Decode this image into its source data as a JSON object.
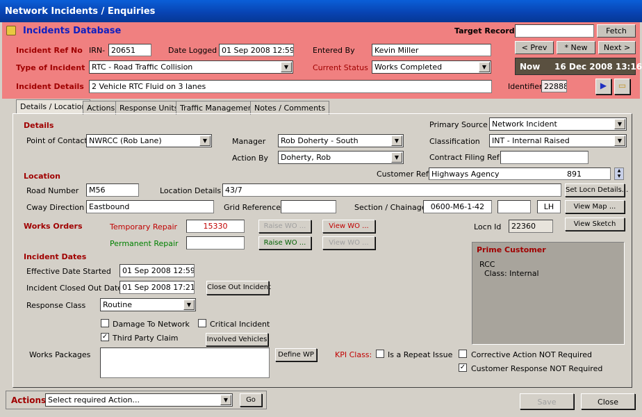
{
  "window": {
    "title": "Network Incidents / Enquiries"
  },
  "header": {
    "db_title": "Incidents Database",
    "target_record_label": "Target Record",
    "target_record_value": "",
    "fetch_label": "Fetch",
    "incident_ref_label": "Incident Ref No",
    "irn_prefix": "IRN-",
    "irn_value": "20651",
    "date_logged_label": "Date Logged",
    "date_logged_value": "01 Sep 2008 12:59",
    "entered_by_label": "Entered By",
    "entered_by_value": "Kevin Miller",
    "prev_label": "< Prev",
    "new_label": "* New",
    "next_label": "Next >",
    "type_label": "Type of Incident",
    "type_value": "RTC - Road Traffic Collision",
    "status_label": "Current Status",
    "status_value": "Works Completed",
    "now_label": "Now",
    "now_value": "16 Dec 2008 13:16",
    "details_label": "Incident Details",
    "details_value": "2 Vehicle RTC Fluid on 3 lanes",
    "identifier_label": "Identifier",
    "identifier_value": "22888"
  },
  "tabs": [
    "Details / Location",
    "Actions",
    "Response Units",
    "Traffic Management",
    "Notes / Comments"
  ],
  "details": {
    "section": "Details",
    "poc_label": "Point of Contact",
    "poc_value": "NWRCC (Rob Lane)",
    "manager_label": "Manager",
    "manager_value": "Rob Doherty - South",
    "action_by_label": "Action By",
    "action_by_value": "Doherty, Rob",
    "primary_source_label": "Primary Source",
    "primary_source_value": "Network Incident",
    "classification_label": "Classification",
    "classification_value": "INT - Internal Raised",
    "contract_filing_label": "Contract Filing Ref",
    "contract_filing_value": ""
  },
  "location": {
    "section": "Location",
    "customer_ref_label": "Customer Ref",
    "customer_ref_value": "Highways Agency",
    "customer_ref_num": "891",
    "road_label": "Road Number",
    "road_value": "M56",
    "loc_details_label": "Location Details",
    "loc_details_value": "43/7",
    "set_locn_label": "Set Locn Details...",
    "cway_label": "Cway Direction",
    "cway_value": "Eastbound",
    "grid_label": "Grid Reference",
    "grid_value": "",
    "section_label": "Section / Chainage",
    "section_value": "0600-M6-1-42",
    "chainage_value": "",
    "side_value": "LH",
    "view_map_label": "View Map ...",
    "view_sketch_label": "View Sketch",
    "locn_id_label": "Locn Id",
    "locn_id_value": "22360"
  },
  "works": {
    "section": "Works Orders",
    "temp_label": "Temporary Repair",
    "temp_value": "15330",
    "perm_label": "Permanent Repair",
    "perm_value": "",
    "raise_wo": "Raise WO ...",
    "view_wo": "View WO ..."
  },
  "dates": {
    "section": "Incident Dates",
    "eff_label": "Effective Date Started",
    "eff_value": "01 Sep 2008 12:59",
    "closed_label": "Incident Closed Out Date",
    "closed_value": "01 Sep 2008 17:21",
    "close_out_label": "Close Out Incident",
    "response_label": "Response Class",
    "response_value": "Routine",
    "damage_label": "Damage To Network",
    "critical_label": "Critical Incident",
    "third_party_label": "Third Party Claim",
    "involved_label": "Involved Vehicles",
    "wp_label": "Works Packages",
    "define_wp_label": "Define WP"
  },
  "kpi": {
    "label": "KPI Class:",
    "repeat_label": "Is a Repeat Issue",
    "corrective_label": "Corrective Action NOT Required",
    "cust_resp_label": "Customer Response NOT Required"
  },
  "prime": {
    "title": "Prime Customer",
    "line1": "RCC",
    "line2": "Class: Internal"
  },
  "footer": {
    "actions_label": "Actions:",
    "actions_value": "Select required Action...",
    "go_label": "Go",
    "save_label": "Save",
    "close_label": "Close"
  },
  "colors": {
    "header_bg": "#f08080",
    "section_red": "#a00000",
    "title_blue": "#0842b0",
    "now_bg": "#5a5040"
  }
}
